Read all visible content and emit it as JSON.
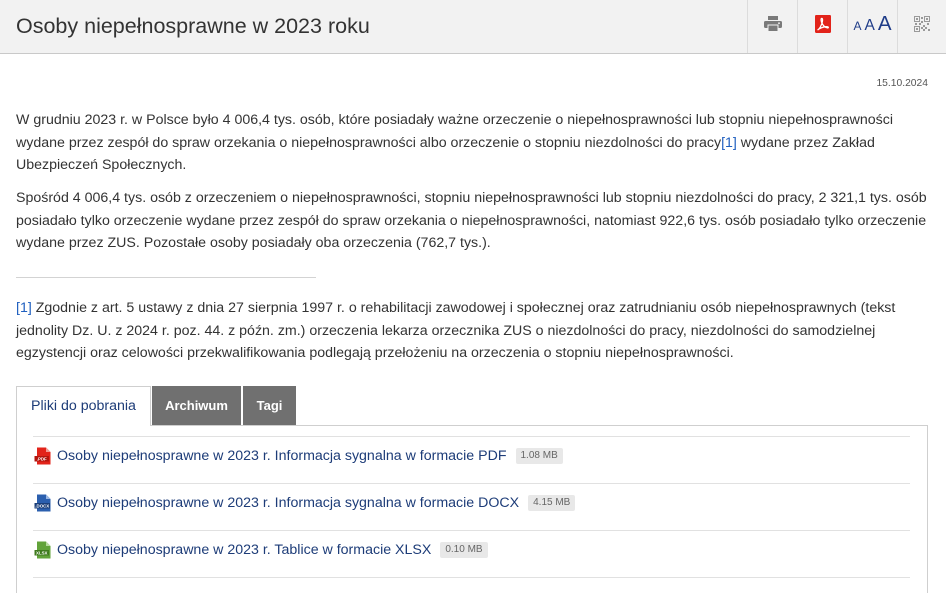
{
  "header": {
    "title": "Osoby niepełnosprawne w 2023 roku",
    "toolbar": {
      "print_icon": "print-icon",
      "pdf_icon": "pdf-icon",
      "font_size_labels": [
        "A",
        "A",
        "A"
      ],
      "qr_icon": "qr-code-icon"
    }
  },
  "date": "15.10.2024",
  "article": {
    "paragraph_1": {
      "text_before_ref": "W grudniu 2023 r. w Polsce było 4 006,4 tys. osób, które posiadały ważne orzeczenie o niepełnosprawności lub stopniu niepełnosprawności wydane przez zespół do spraw orzekania o niepełnosprawności albo orzeczenie o stopniu niezdolności do pracy",
      "ref": "[1]",
      "text_after_ref": " wydane przez Zakład Ubezpieczeń Społecznych."
    },
    "paragraph_2": "Spośród 4 006,4 tys. osób z orzeczeniem o niepełnosprawności, stopniu niepełnosprawności lub stopniu niezdolności do pracy, 2 321,1 tys. osób posiadało tylko orzeczenie wydane przez zespół do spraw orzekania o niepełnosprawności, natomiast 922,6 tys. osób posiadało tylko orzeczenie wydane przez ZUS. Pozostałe osoby posiadały oba orzeczenia (762,7 tys.).",
    "footnote": {
      "ref": "[1]",
      "text": " Zgodnie z art. 5 ustawy z dnia 27 sierpnia 1997 r. o rehabilitacji zawodowej i społecznej oraz zatrudnianiu osób niepełnosprawnych (tekst jednolity Dz. U. z 2024 r. poz. 44. z późn. zm.) orzeczenia lekarza orzecznika ZUS o niezdolności do pracy, niezdolności do samodzielnej egzystencji oraz celowości przekwalifikowania podlegają przełożeniu na orzeczenia o stopniu niepełnosprawności."
    }
  },
  "tabs": [
    {
      "label": "Pliki do pobrania",
      "active": true
    },
    {
      "label": "Archiwum",
      "active": false
    },
    {
      "label": "Tagi",
      "active": false
    }
  ],
  "downloads": [
    {
      "icon": "pdf-file-icon",
      "icon_label": ".PDF",
      "title": "Osoby niepełnosprawne w 2023 r. Informacja sygnalna w formacie PDF",
      "size": "1.08 MB"
    },
    {
      "icon": "docx-file-icon",
      "icon_label": ".DOCX",
      "title": "Osoby niepełnosprawne w 2023 r. Informacja sygnalna w formacie DOCX",
      "size": "4.15 MB"
    },
    {
      "icon": "xlsx-file-icon",
      "icon_label": "XLSX",
      "title": "Osoby niepełnosprawne w 2023 r. Tablice w formacie XLSX",
      "size": "0.10 MB"
    }
  ],
  "colors": {
    "header_bg": "#f2f2f2",
    "text": "#333333",
    "link": "#1d3c78",
    "footnote_ref": "#1f5fbf",
    "tab_inactive_bg": "#707070",
    "font_size_control": "#1f3c88",
    "pdf": "#e2231a",
    "docx": "#2b5fae",
    "xlsx": "#62a33a"
  }
}
